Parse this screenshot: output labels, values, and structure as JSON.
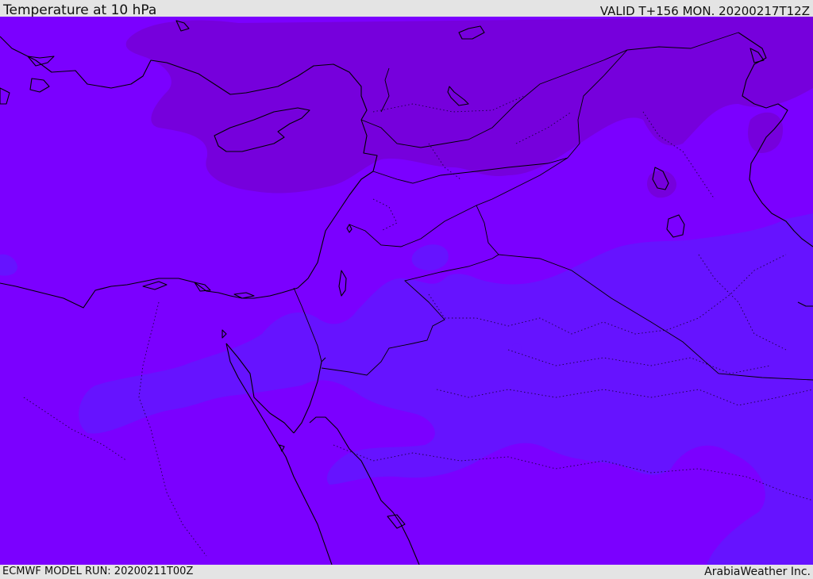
{
  "header": {
    "title": "Temperature at 10 hPa",
    "valid_time": "VALID T+156 MON. 20200217T12Z"
  },
  "footer": {
    "model_run": "ECMWF MODEL RUN: 20200211T00Z",
    "credit": "ArabiaWeather Inc."
  },
  "colors": {
    "base_field": "#7b00ff",
    "warm_band": "#7600dc",
    "cool_band": "#6613ff",
    "coastline": "#000000",
    "panel_background": "#e4e4e4"
  }
}
